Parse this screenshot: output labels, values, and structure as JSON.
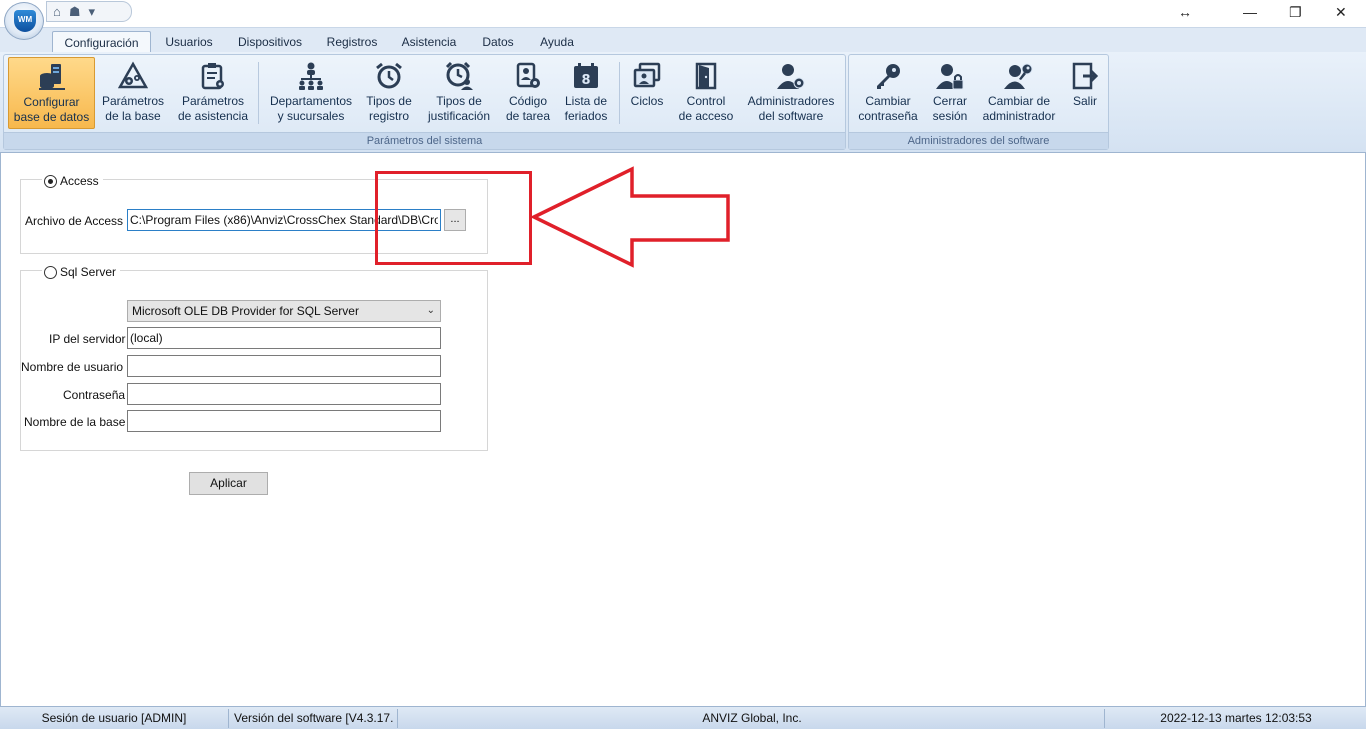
{
  "window": {
    "app_logo_text": "WM",
    "resize_glyph": "↔",
    "minimize_glyph": "—",
    "restore_glyph": "❐",
    "close_glyph": "✕"
  },
  "ribbon": {
    "tabs": [
      "Configuración",
      "Usuarios",
      "Dispositivos",
      "Registros",
      "Asistencia",
      "Datos",
      "Ayuda"
    ],
    "active_tab": "Configuración",
    "groups": {
      "sistema": {
        "label": "Parámetros del sistema",
        "buttons": [
          {
            "line1": "Configurar",
            "line2": "base de datos",
            "icon": "database-server-icon"
          },
          {
            "line1": "Parámetros",
            "line2": "de la base",
            "icon": "gears-triangle-icon"
          },
          {
            "line1": "Parámetros",
            "line2": "de asistencia",
            "icon": "clipboard-gear-icon"
          },
          {
            "line1": "Departamentos",
            "line2": "y sucursales",
            "icon": "org-chart-icon"
          },
          {
            "line1": "Tipos de",
            "line2": "registro",
            "icon": "alarm-clock-icon"
          },
          {
            "line1": "Tipos de",
            "line2": "justificación",
            "icon": "clock-user-icon"
          },
          {
            "line1": "Código",
            "line2": "de tarea",
            "icon": "task-code-icon"
          },
          {
            "line1": "Lista de",
            "line2": "feriados",
            "icon": "calendar-icon"
          },
          {
            "line1": "Ciclos",
            "line2": "",
            "icon": "cycles-icon"
          },
          {
            "line1": "Control",
            "line2": "de acceso",
            "icon": "door-icon"
          },
          {
            "line1": "Administradores",
            "line2": "del software",
            "icon": "admin-gear-icon"
          }
        ]
      },
      "admin": {
        "label": "Administradores del software",
        "buttons": [
          {
            "line1": "Cambiar",
            "line2": "contraseña",
            "icon": "key-icon"
          },
          {
            "line1": "Cerrar",
            "line2": "sesión",
            "icon": "user-lock-icon"
          },
          {
            "line1": "Cambiar de",
            "line2": "administrador",
            "icon": "user-key-icon"
          },
          {
            "line1": "Salir",
            "line2": "",
            "icon": "exit-icon"
          }
        ]
      }
    }
  },
  "access": {
    "legend": "Access",
    "selected": true,
    "file_label": "Archivo de Access",
    "file_value": "C:\\Program Files (x86)\\Anviz\\CrossChex Standard\\DB\\Cros",
    "browse_label": "..."
  },
  "sql": {
    "legend": "Sql Server",
    "selected": false,
    "provider": "Microsoft OLE DB Provider for SQL Server",
    "server_ip_label": "IP del servidor",
    "server_ip_value": "(local)",
    "user_label": "Nombre de usuario",
    "user_value": "",
    "password_label": "Contraseña",
    "password_value": "",
    "dbname_label": "Nombre de la base",
    "dbname_value": ""
  },
  "apply_label": "Aplicar",
  "status": {
    "session": "Sesión de usuario  [ADMIN]",
    "version": "Versión del software  [V4.3.17.",
    "company": "ANVIZ Global, Inc.",
    "datetime": "2022-12-13 martes 12:03:53"
  },
  "colors": {
    "annotation": "#e0202a",
    "selected_button": "#f7b84d",
    "ribbon_bg": "#dbe7f5"
  }
}
